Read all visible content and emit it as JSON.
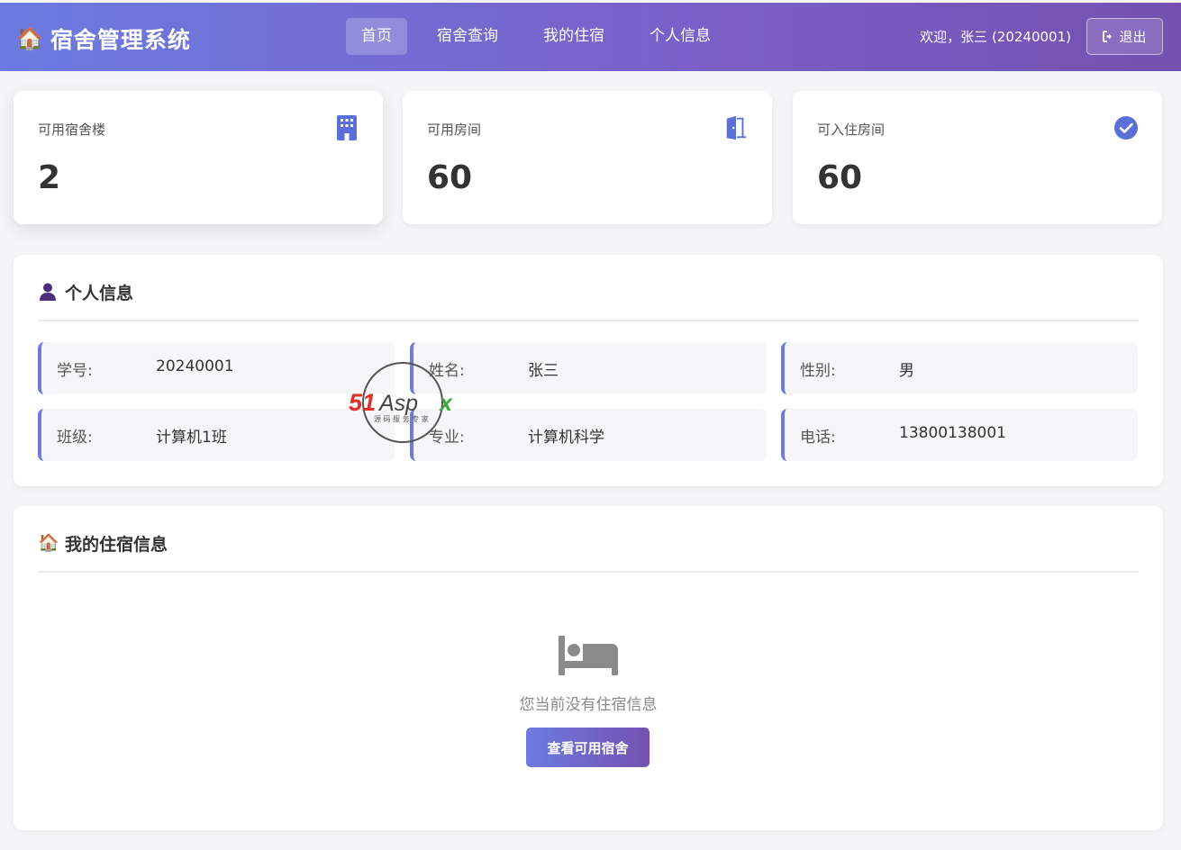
{
  "header": {
    "brand_icon": "🏠",
    "brand_title": "宿舍管理系统",
    "nav": [
      {
        "label": "首页",
        "active": true
      },
      {
        "label": "宿舍查询",
        "active": false
      },
      {
        "label": "我的住宿",
        "active": false
      },
      {
        "label": "个人信息",
        "active": false
      }
    ],
    "welcome": "欢迎，张三 (20240001)",
    "logout_label": "退出"
  },
  "stats": [
    {
      "label": "可用宿舍楼",
      "value": "2",
      "icon": "building-icon"
    },
    {
      "label": "可用房间",
      "value": "60",
      "icon": "door-open-icon"
    },
    {
      "label": "可入住房间",
      "value": "60",
      "icon": "check-circle-icon"
    }
  ],
  "profile": {
    "title": "个人信息",
    "icon": "user-icon",
    "fields": [
      {
        "key": "学号:",
        "value": "20240001"
      },
      {
        "key": "姓名:",
        "value": "张三"
      },
      {
        "key": "性别:",
        "value": "男"
      },
      {
        "key": "班级:",
        "value": "计算机1班"
      },
      {
        "key": "专业:",
        "value": "计算机科学"
      },
      {
        "key": "电话:",
        "value": "13800138001"
      }
    ]
  },
  "residence": {
    "title": "我的住宿信息",
    "icon": "🏠",
    "empty_text": "您当前没有住宿信息",
    "cta_label": "查看可用宿舍"
  },
  "watermark": {
    "brand": "51Aspx",
    "tagline": "源码服务专家"
  },
  "colors": {
    "accent": "#6c7be0",
    "accent_dark": "#7451b0",
    "icon_blue": "#5a6fd8",
    "user_purple": "#4a2f7a"
  }
}
